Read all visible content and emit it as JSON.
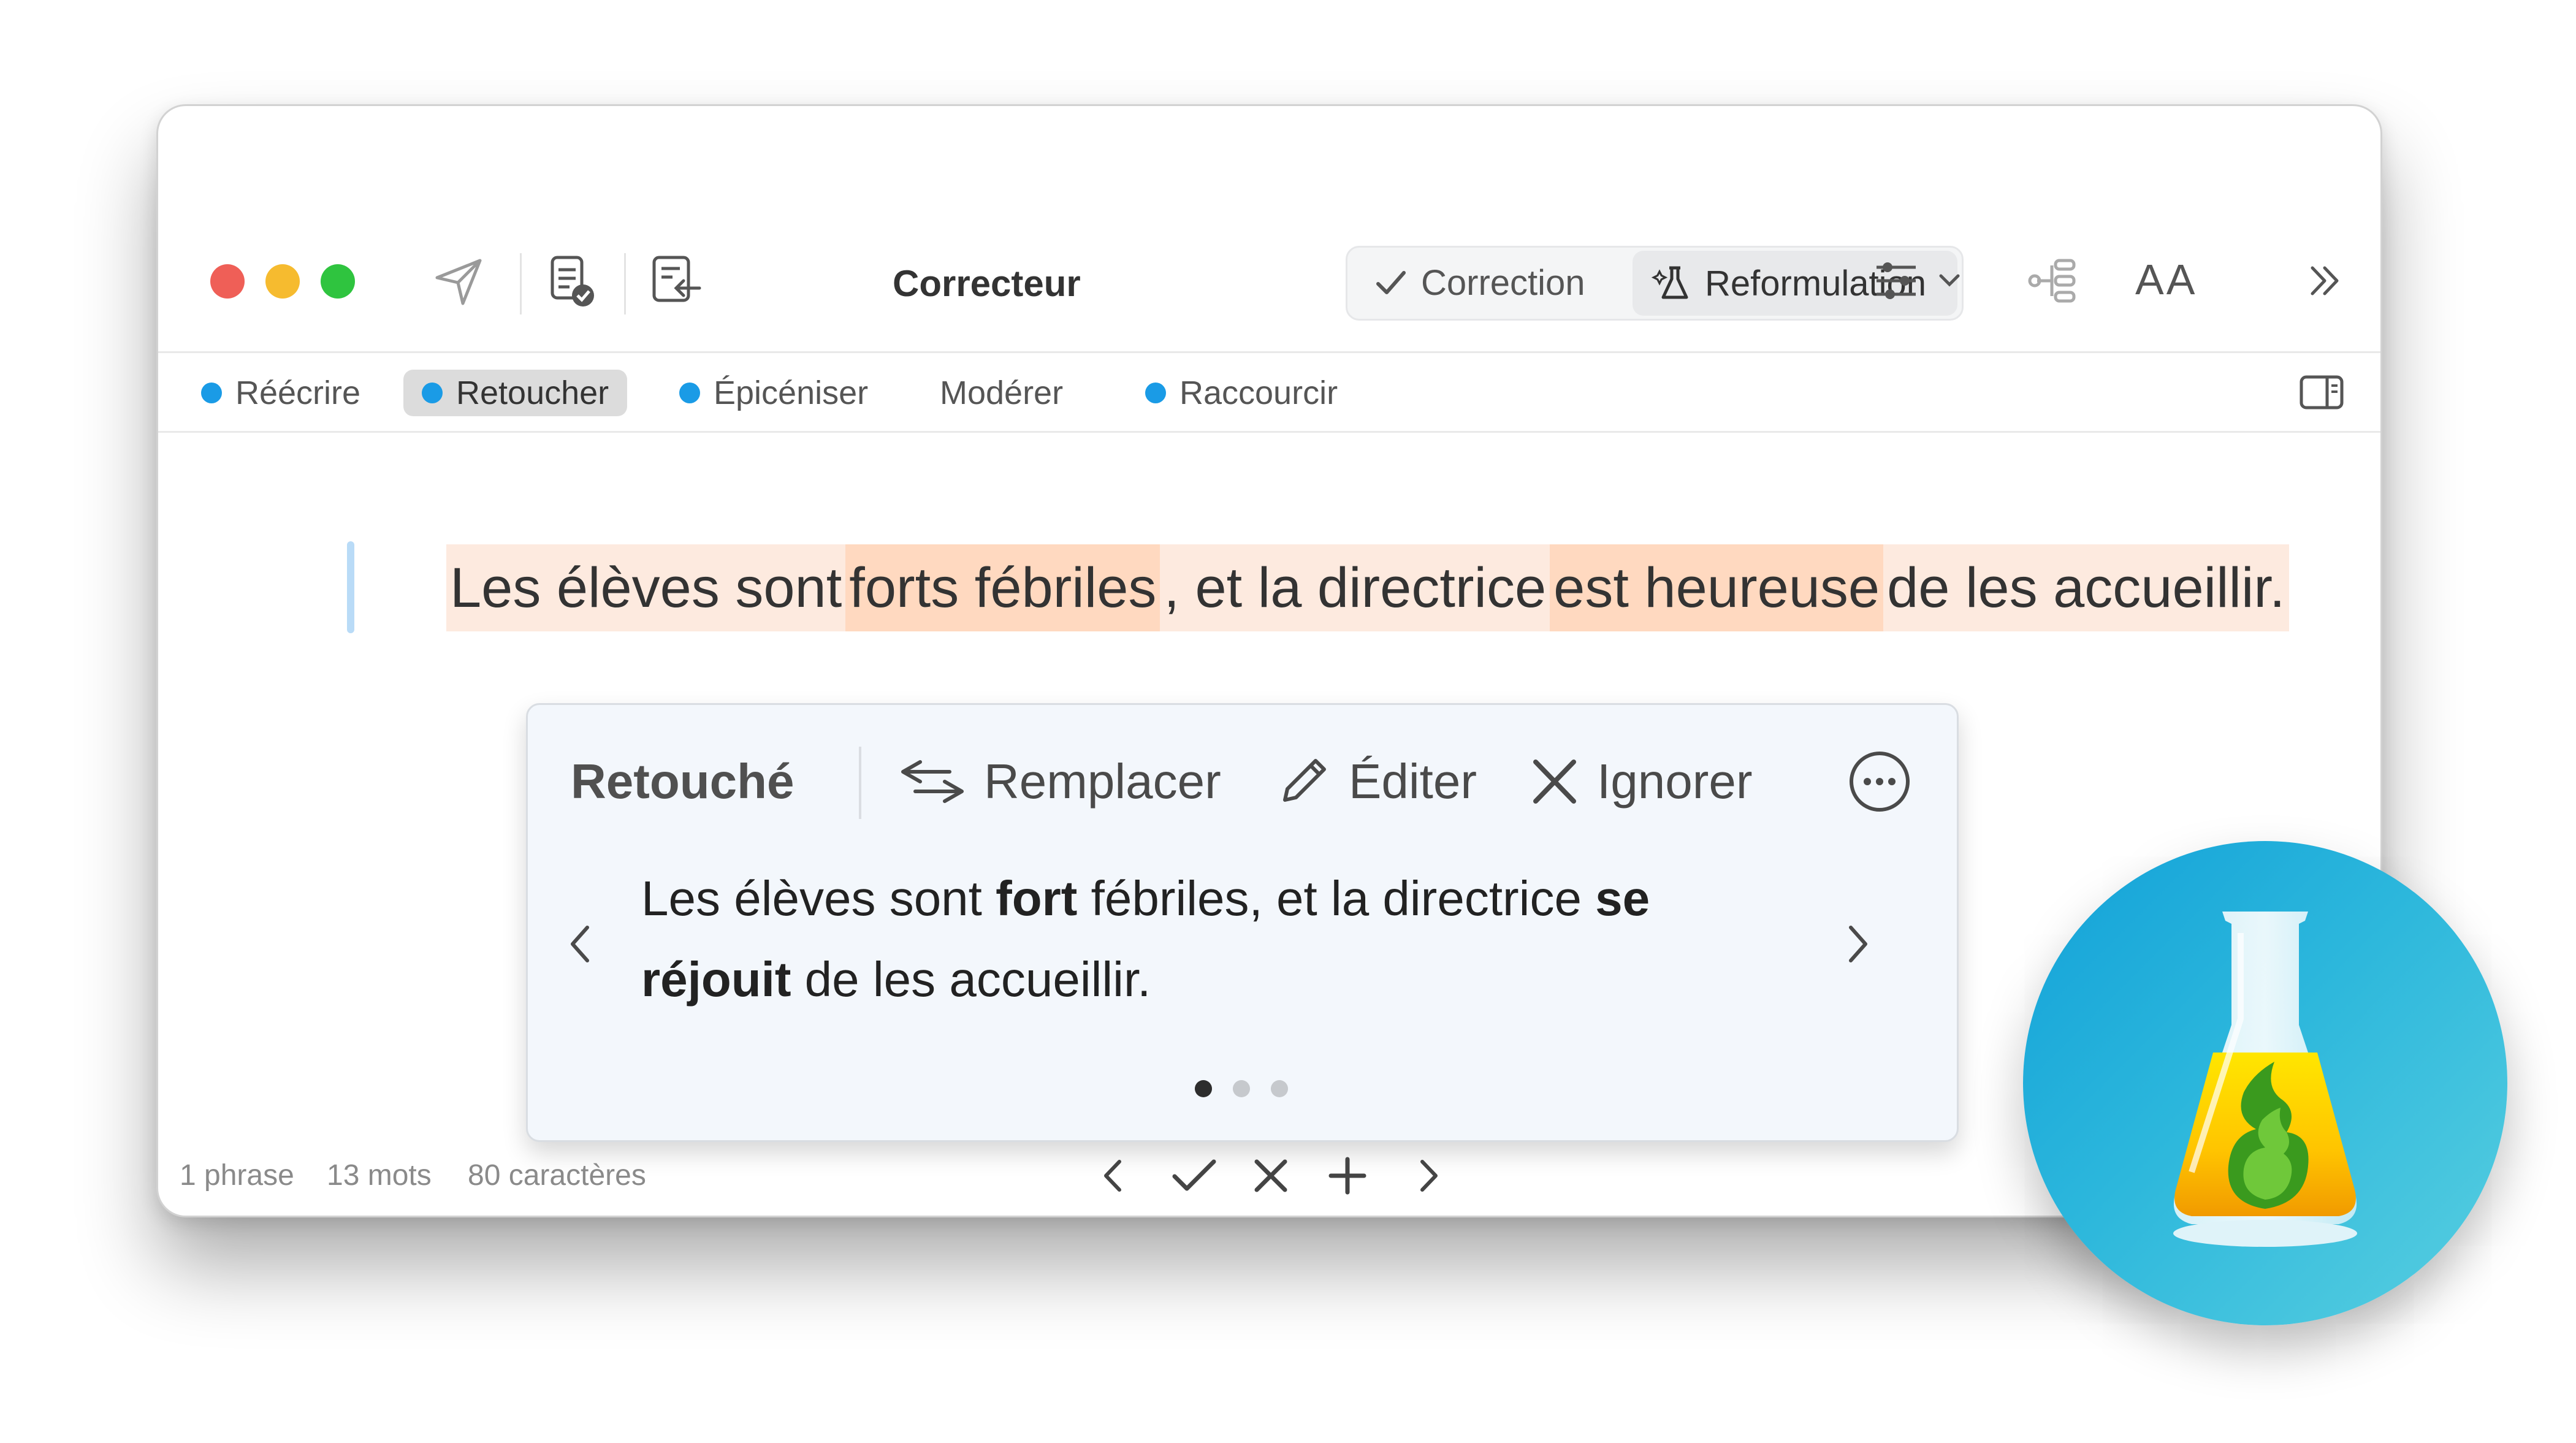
{
  "window": {
    "title": "Correcteur",
    "segments": {
      "correction": "Correction",
      "reformulation": "Reformulation"
    },
    "font_size_button": "AA",
    "traffic_lights": [
      "#ef5f57",
      "#f6bb2f",
      "#2fc43f"
    ]
  },
  "toolbar_icons": [
    "send-icon",
    "document-check-icon",
    "import-text-icon",
    "sliders-icon",
    "chevron-down-icon",
    "tree-list-icon",
    "font-size-icon",
    "double-chevron-right-icon",
    "sidebar-toggle-icon"
  ],
  "tabs": [
    {
      "label": "Réécrire",
      "dot": true,
      "selected": false
    },
    {
      "label": "Retoucher",
      "dot": true,
      "selected": true
    },
    {
      "label": "Épicéniser",
      "dot": true,
      "selected": false
    },
    {
      "label": "Modérer",
      "dot": false,
      "selected": false
    },
    {
      "label": "Raccourcir",
      "dot": true,
      "selected": false
    }
  ],
  "sentence": {
    "parts": [
      "Les élèves sont ",
      "forts fébriles",
      ", et la directrice ",
      "est heureuse",
      " de les accueillir."
    ],
    "highlight_colors": {
      "light": "#fdeadf",
      "strong": "#ffd9c0"
    }
  },
  "suggestion": {
    "title": "Retouché",
    "actions": {
      "replace": "Remplacer",
      "edit": "Éditer",
      "ignore": "Ignorer"
    },
    "text_parts": [
      "Les élèves sont ",
      "fort",
      " fébriles, et la directrice ",
      "se réjouit",
      " de les accueillir."
    ],
    "page_index": 1,
    "page_count": 3
  },
  "status": {
    "sentences": "1 phrase",
    "words": "13 mots",
    "characters": "80 caractères"
  },
  "bottom_nav": [
    "chevron-left-icon",
    "checkmark-icon",
    "close-icon",
    "plus-icon",
    "chevron-right-icon"
  ],
  "accent_color": "#1a9be6"
}
